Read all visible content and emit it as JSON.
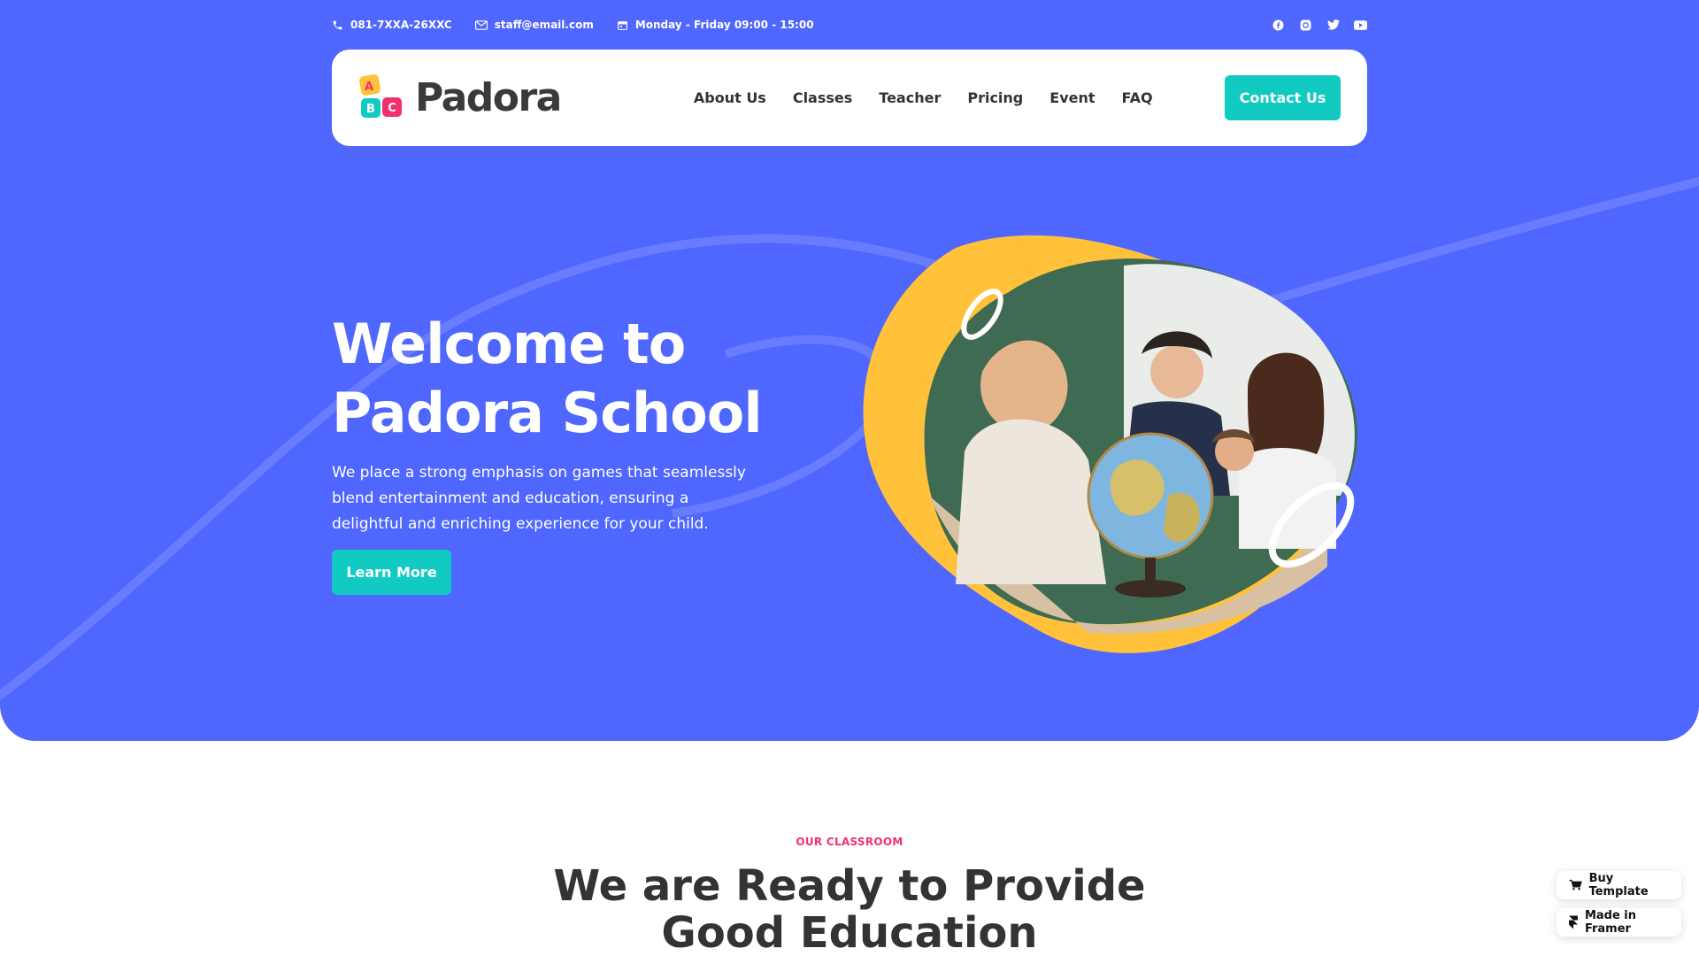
{
  "colors": {
    "hero_bg": "#4f66ff",
    "accent_teal": "#11cbc2",
    "accent_pink": "#f1316c",
    "accent_yellow": "#ffc23a"
  },
  "topbar": {
    "phone": "081-7XXA-26XXC",
    "email": "staff@email.com",
    "hours": "Monday - Friday 09:00 - 15:00",
    "socials": [
      "facebook-icon",
      "instagram-icon",
      "twitter-icon",
      "youtube-icon"
    ]
  },
  "brand": {
    "name": "Padora",
    "blocks": [
      "A",
      "B",
      "C"
    ]
  },
  "nav": {
    "items": [
      "About Us",
      "Classes",
      "Teacher",
      "Pricing",
      "Event",
      "FAQ"
    ],
    "cta": "Contact Us"
  },
  "hero": {
    "title_line1": "Welcome to",
    "title_line2": "Padora School",
    "description": "We place a strong emphasis on games that seamlessly blend entertainment and education, ensuring a delightful and enriching experience for your child.",
    "cta": "Learn More"
  },
  "section": {
    "tag": "OUR CLASSROOM",
    "title_line1": "We are Ready to Provide",
    "title_line2": "Good Education"
  },
  "badges": {
    "buy": "Buy Template",
    "framer": "Made in Framer"
  }
}
